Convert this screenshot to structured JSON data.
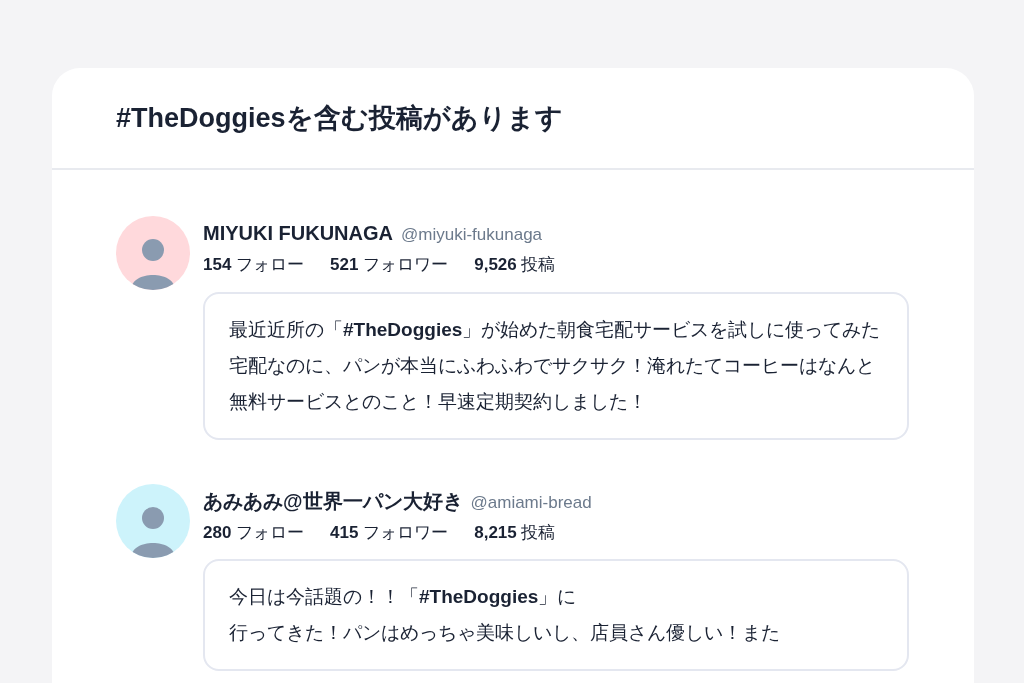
{
  "header": {
    "title": "#TheDoggiesを含む投稿があります"
  },
  "posts": [
    {
      "avatar": {
        "color": "#ffd9dc"
      },
      "name": "MIYUKI FUKUNAGA",
      "handle": "@miyuki-fukunaga",
      "stats": [
        "**154** フォロー",
        "**521** フォロワー",
        "**9,526** 投稿"
      ],
      "paragraphs": [
        "最近近所の「**#TheDoggies**」が始めた朝食宅配サービスを試しに使ってみた",
        "宅配なのに、パンが本当にふわふわでサクサク！淹れたてコーヒーはなんと無料サービスとのこと！早速定期契約しました！"
      ]
    },
    {
      "avatar": {
        "color": "#cdf3fb"
      },
      "name": "あみあみ@世界一パン大好き",
      "handle": "@amiami-bread",
      "stats": [
        "**280** フォロー",
        "**415** フォロワー",
        "**8,215** 投稿"
      ],
      "paragraphs": [
        "今日は今話題の！！「**#TheDoggies**」に",
        "行ってきた！パンはめっちゃ美味しいし、店員さん優しい！また"
      ]
    }
  ]
}
